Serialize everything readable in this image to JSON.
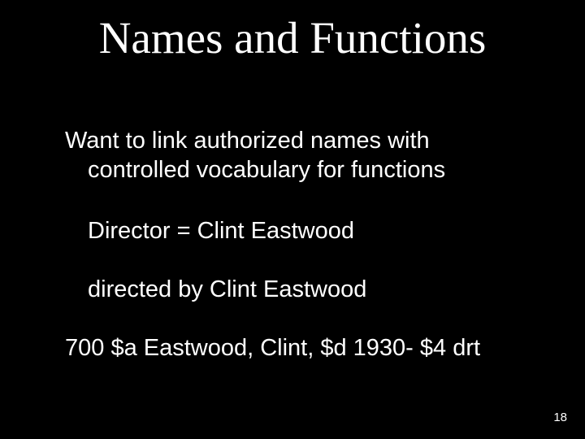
{
  "slide": {
    "title": "Names and Functions",
    "intro_line1": "Want to link authorized names with",
    "intro_line2": "controlled vocabulary for functions",
    "example_director": "Director = Clint Eastwood",
    "example_directed_by": "directed by Clint Eastwood",
    "marc_field": "700 $a Eastwood, Clint, $d 1930- $4 drt",
    "page_number": "18"
  }
}
